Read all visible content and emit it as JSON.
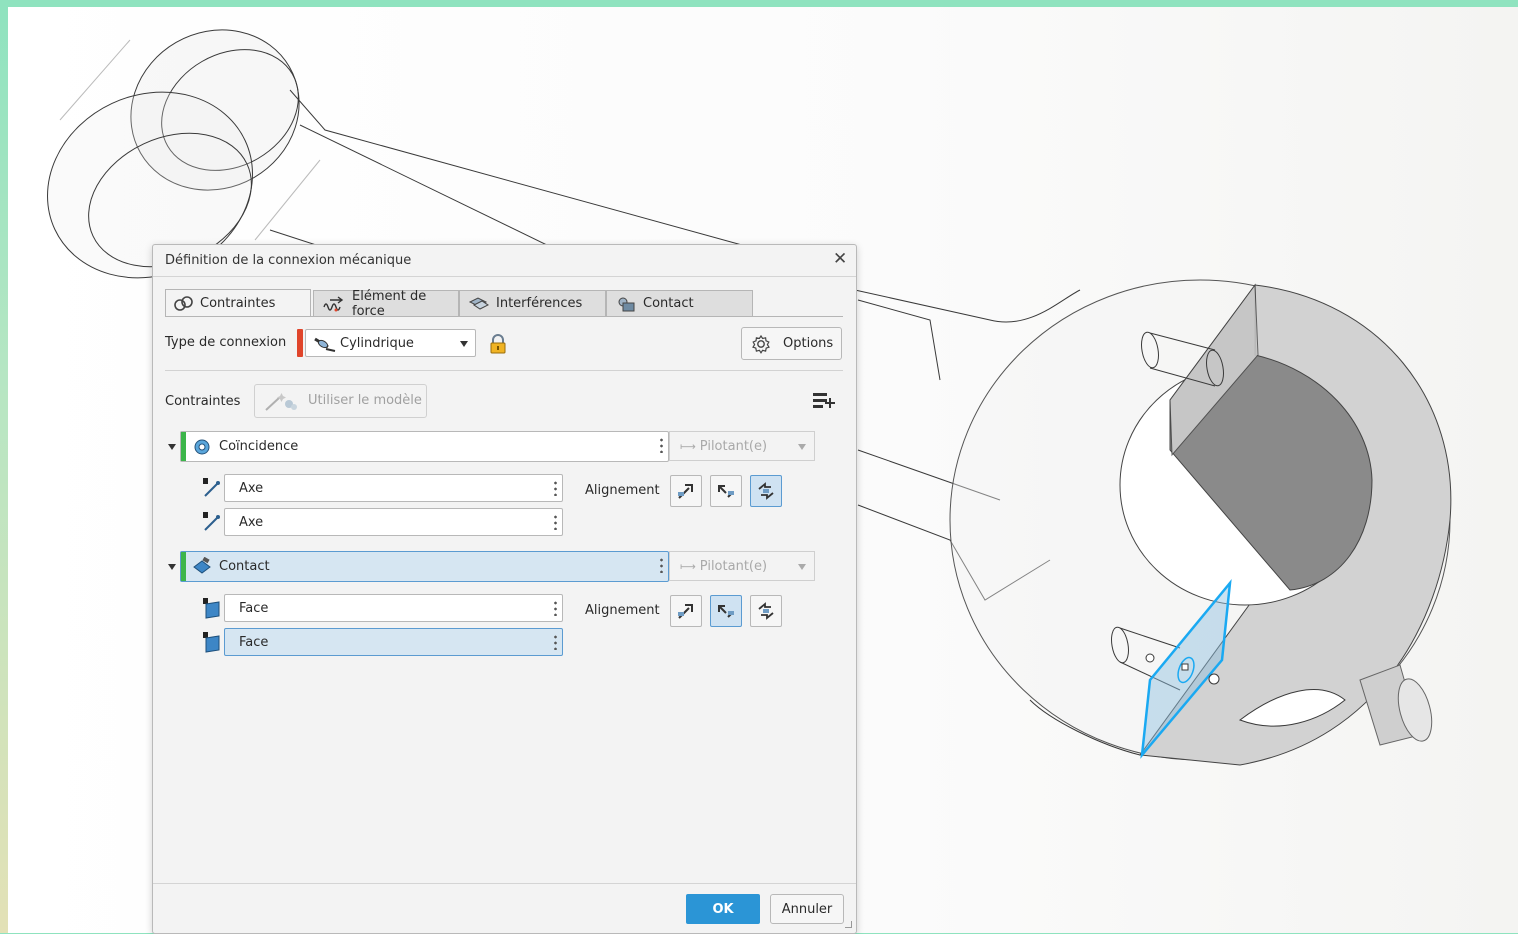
{
  "dialog": {
    "title": "Définition de la connexion mécanique",
    "close_glyph": "✕",
    "tabs": [
      {
        "label": "Contraintes",
        "icon": "constraints-icon",
        "active": true
      },
      {
        "label": "Elément de force",
        "icon": "spring-force-icon",
        "active": false
      },
      {
        "label": "Interférences",
        "icon": "interference-icon",
        "active": false
      },
      {
        "label": "Contact",
        "icon": "contact-bodies-icon",
        "active": false
      }
    ],
    "connection": {
      "label": "Type de connexion",
      "selected": "Cylindrique",
      "status_color": "#e0452b",
      "options_button": "Options"
    },
    "constraints": {
      "label": "Contraintes",
      "use_model_button": "Utiliser le modèle",
      "groups": [
        {
          "name": "Coïncidence",
          "driving": "Pilotant(e)",
          "alignment_label": "Alignement",
          "refs": [
            "Axe",
            "Axe"
          ],
          "alignment_active_index": 2
        },
        {
          "name": "Contact",
          "driving": "Pilotant(e)",
          "alignment_label": "Alignement",
          "refs": [
            "Face",
            "Face"
          ],
          "alignment_active_index": 1
        }
      ]
    },
    "footer": {
      "ok": "OK",
      "cancel": "Annuler"
    }
  },
  "colors": {
    "accent": "#3a9fe0",
    "ok_button": "#2b95d6",
    "group_bar": "#3cb54a",
    "selection_edge": "#1aa9f2"
  }
}
